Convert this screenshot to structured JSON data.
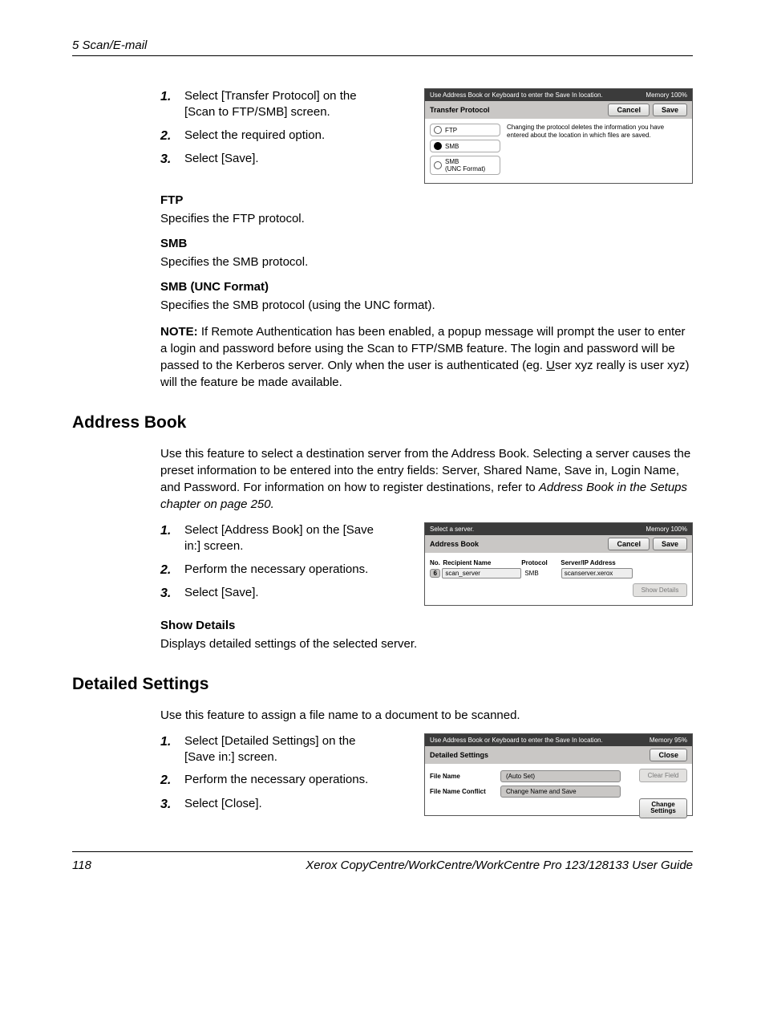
{
  "running_head": "5 Scan/E-mail",
  "block1": {
    "steps": [
      "Select [Transfer Protocol] on the [Scan to FTP/SMB] screen.",
      "Select the required option.",
      "Select [Save]."
    ],
    "ftp_h": "FTP",
    "ftp_p": "Specifies the FTP protocol.",
    "smb_h": "SMB",
    "smb_p": "Specifies the SMB protocol.",
    "smbu_h": "SMB (UNC Format)",
    "smbu_p": "Specifies the SMB protocol (using the UNC format).",
    "note_lead": "NOTE:",
    "note_body_a": " If Remote Authentication has been enabled, a popup message will prompt the user to enter a login and password before using the Scan to FTP/SMB feature. The login and password will be passed to the Kerberos server. Only when the user is authenticated (eg. ",
    "note_u": "U",
    "note_body_b": "ser xyz really is user xyz) will the feature be made available."
  },
  "fig1": {
    "top_instr": "Use Address Book or Keyboard to enter the Save In location.",
    "memory": "Memory 100%",
    "title": "Transfer Protocol",
    "cancel": "Cancel",
    "save": "Save",
    "opt_ftp": "FTP",
    "opt_smb": "SMB",
    "opt_smbu_a": "SMB",
    "opt_smbu_b": "(UNC Format)",
    "msg": "Changing the protocol deletes the information you have entered about the location in which files are saved."
  },
  "addrbook": {
    "heading": "Address Book",
    "intro_a": "Use this feature to select a destination server from the Address Book. Selecting a server causes the preset information to be entered into the entry fields: Server, Shared Name, Save in, Login Name, and Password. For information on how to register destinations, refer to ",
    "intro_i": "Address Book in the Setups chapter on page 250.",
    "steps": [
      "Select [Address Book] on the [Save in:] screen.",
      "Perform the necessary operations.",
      "Select [Save]."
    ],
    "show_h": "Show Details",
    "show_p": "Displays detailed settings of the selected server."
  },
  "fig2": {
    "top_instr": "Select a server.",
    "memory": "Memory 100%",
    "title": "Address Book",
    "cancel": "Cancel",
    "save": "Save",
    "col_no": "No.",
    "col_rn": "Recipient Name",
    "col_proto": "Protocol",
    "col_srv": "Server/IP Address",
    "row_no": "6",
    "row_rn": "scan_server",
    "row_proto": "SMB",
    "row_srv": "scanserver.xerox",
    "show_details": "Show Details"
  },
  "detailed": {
    "heading": "Detailed Settings",
    "intro": "Use this feature to assign a file name to a document to be scanned.",
    "steps": [
      "Select [Detailed Settings] on the [Save in:] screen.",
      "Perform the necessary operations.",
      "Select [Close]."
    ]
  },
  "fig3": {
    "top_instr": "Use Address Book or Keyboard to enter the Save In location.",
    "memory": "Memory  95%",
    "title": "Detailed Settings",
    "close": "Close",
    "k_fn": "File Name",
    "v_fn": "(Auto Set)",
    "k_fnc": "File Name Conflict",
    "v_fnc": "Change Name and Save",
    "clear": "Clear Field",
    "change": "Change Settings"
  },
  "footer": {
    "page": "118",
    "guide": "Xerox CopyCentre/WorkCentre/WorkCentre Pro 123/128133 User Guide"
  }
}
